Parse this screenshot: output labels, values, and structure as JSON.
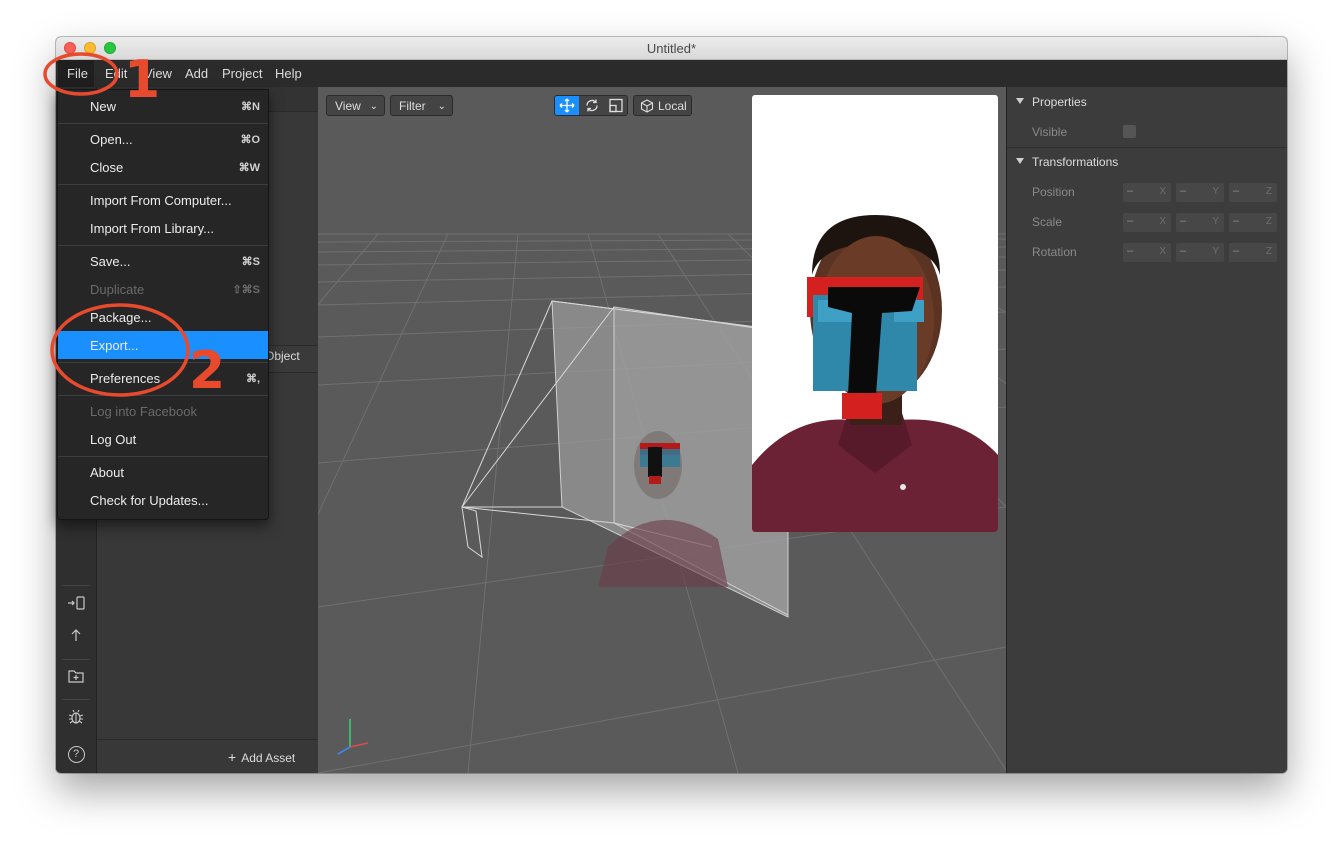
{
  "window": {
    "title": "Untitled*"
  },
  "menubar": {
    "items": [
      "File",
      "Edit",
      "View",
      "Add",
      "Project",
      "Help"
    ]
  },
  "file_menu": {
    "items": [
      {
        "label": "New",
        "shortcut": "⌘N",
        "enabled": true
      },
      {
        "label": "Open...",
        "shortcut": "⌘O",
        "enabled": true
      },
      {
        "label": "Close",
        "shortcut": "⌘W",
        "enabled": true
      },
      {
        "label": "Import From Computer...",
        "shortcut": "",
        "enabled": true
      },
      {
        "label": "Import From Library...",
        "shortcut": "",
        "enabled": true
      },
      {
        "label": "Save...",
        "shortcut": "⌘S",
        "enabled": true
      },
      {
        "label": "Duplicate",
        "shortcut": "⇧⌘S",
        "enabled": false
      },
      {
        "label": "Package...",
        "shortcut": "",
        "enabled": true
      },
      {
        "label": "Export...",
        "shortcut": "",
        "enabled": true,
        "highlighted": true
      },
      {
        "label": "Preferences",
        "shortcut": "⌘,",
        "enabled": true
      },
      {
        "label": "Log into Facebook",
        "shortcut": "",
        "enabled": false
      },
      {
        "label": "Log Out",
        "shortcut": "",
        "enabled": true
      },
      {
        "label": "About",
        "shortcut": "",
        "enabled": true
      },
      {
        "label": "Check for Updates...",
        "shortcut": "",
        "enabled": true
      }
    ]
  },
  "assets": {
    "partial_label": "Object",
    "add_asset_label": "Add Asset"
  },
  "viewport_toolbar": {
    "view_label": "View",
    "filter_label": "Filter",
    "local_label": "Local"
  },
  "properties": {
    "section1": "Properties",
    "visible_label": "Visible",
    "section2": "Transformations",
    "rows": [
      {
        "label": "Position",
        "fields": [
          {
            "value": "–",
            "axis": "X"
          },
          {
            "value": "–",
            "axis": "Y"
          },
          {
            "value": "–",
            "axis": "Z"
          }
        ]
      },
      {
        "label": "Scale",
        "fields": [
          {
            "value": "–",
            "axis": "X"
          },
          {
            "value": "–",
            "axis": "Y"
          },
          {
            "value": "–",
            "axis": "Z"
          }
        ]
      },
      {
        "label": "Rotation",
        "fields": [
          {
            "value": "–",
            "axis": "X"
          },
          {
            "value": "–",
            "axis": "Y"
          },
          {
            "value": "–",
            "axis": "Z"
          }
        ]
      }
    ]
  },
  "annotations": {
    "step1": "1",
    "step2": "2"
  },
  "left_toolbar": {
    "icons": [
      "send-to-device-icon",
      "upload-icon",
      "add-folder-icon",
      "bug-icon",
      "help-icon"
    ],
    "help_glyph": "?"
  },
  "colors": {
    "accent": "#1a8fff",
    "annotation": "#e84a2e",
    "selected_tool": "#1a8fff"
  }
}
